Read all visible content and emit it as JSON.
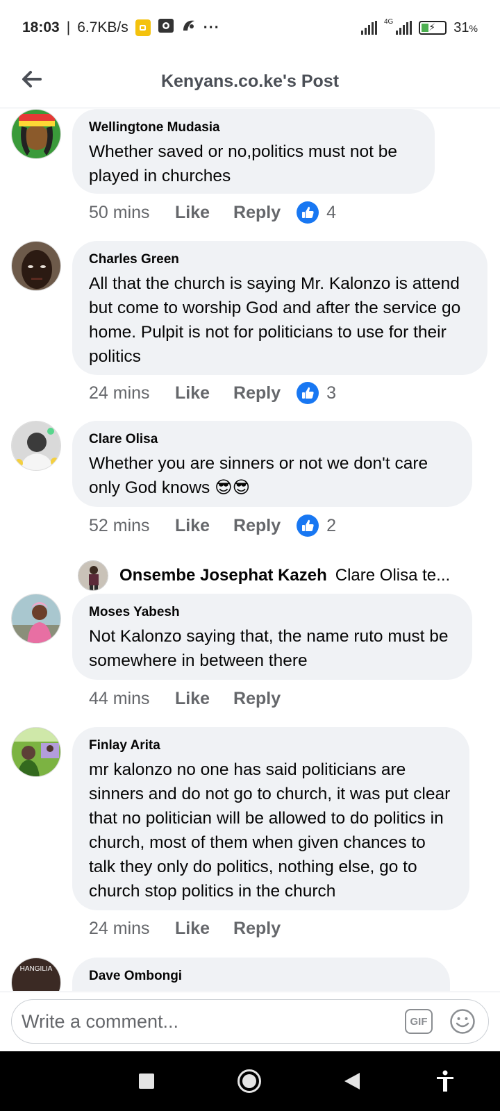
{
  "status_bar": {
    "time": "18:03",
    "speed": "6.7KB/s",
    "network_label": "4G",
    "battery_percent": "31",
    "battery_unit": "%",
    "battery_level": 0.31,
    "overflow": "···"
  },
  "header": {
    "title": "Kenyans.co.ke's Post"
  },
  "comments": [
    {
      "author": "Wellingtone Mudasia",
      "text": "Whether saved or no,politics must not be played in churches",
      "time": "50 mins",
      "like_label": "Like",
      "reply_label": "Reply",
      "reaction_count": "4"
    },
    {
      "author": "Charles Green",
      "text": "All that the church is saying Mr. Kalonzo is attend but come to worship God and after the service go home. Pulpit is not for politicians to use for their politics",
      "time": "24 mins",
      "like_label": "Like",
      "reply_label": "Reply",
      "reaction_count": "3"
    },
    {
      "author": "Clare Olisa",
      "text": "Whether you are sinners or not we don't care only God knows 😎😎",
      "time": "52 mins",
      "like_label": "Like",
      "reply_label": "Reply",
      "reaction_count": "2"
    },
    {
      "author": "Moses Yabesh",
      "text": "Not Kalonzo saying that, the name ruto must be somewhere in between there",
      "time": "44 mins",
      "like_label": "Like",
      "reply_label": "Reply"
    },
    {
      "author": "Finlay Arita",
      "text": "mr kalonzo no one has said politicians are sinners and do not go to church, it was put clear that no politician will be allowed to do politics in church, most of them when given chances to talk they only do politics, nothing else, go to church stop politics in the church",
      "time": "24 mins",
      "like_label": "Like",
      "reply_label": "Reply"
    },
    {
      "author": "Dave Ombongi"
    }
  ],
  "reply_preview": {
    "author": "Onsembe Josephat Kazeh",
    "text": "Clare Olisa te..."
  },
  "partial_avatar_text": "HANGILIA",
  "comment_input": {
    "placeholder": "Write a comment...",
    "gif_label": "GIF"
  },
  "colors": {
    "bubble": "#f0f2f5",
    "like_blue": "#1877f2",
    "meta_gray": "#65676b"
  }
}
